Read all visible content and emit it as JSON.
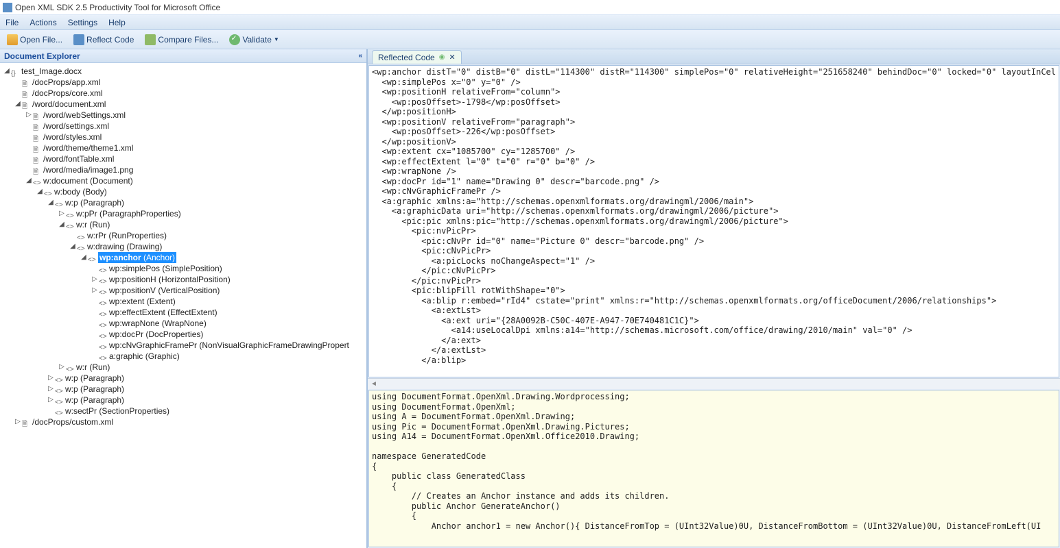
{
  "app": {
    "title": "Open XML SDK 2.5 Productivity Tool for Microsoft Office"
  },
  "menu": {
    "file": "File",
    "actions": "Actions",
    "settings": "Settings",
    "help": "Help"
  },
  "toolbar": {
    "open": "Open File...",
    "reflect": "Reflect Code",
    "compare": "Compare Files...",
    "validate": "Validate"
  },
  "explorer": {
    "title": "Document Explorer",
    "nodes": [
      {
        "d": 0,
        "t": "e",
        "i": "braces",
        "l": "test_Image.docx"
      },
      {
        "d": 1,
        "t": "l",
        "i": "doc",
        "l": "/docProps/app.xml"
      },
      {
        "d": 1,
        "t": "l",
        "i": "doc",
        "l": "/docProps/core.xml"
      },
      {
        "d": 1,
        "t": "e",
        "i": "doc",
        "l": "/word/document.xml"
      },
      {
        "d": 2,
        "t": "c",
        "i": "doc",
        "l": "/word/webSettings.xml"
      },
      {
        "d": 2,
        "t": "l",
        "i": "doc",
        "l": "/word/settings.xml"
      },
      {
        "d": 2,
        "t": "l",
        "i": "doc",
        "l": "/word/styles.xml"
      },
      {
        "d": 2,
        "t": "l",
        "i": "doc",
        "l": "/word/theme/theme1.xml"
      },
      {
        "d": 2,
        "t": "l",
        "i": "doc",
        "l": "/word/fontTable.xml"
      },
      {
        "d": 2,
        "t": "l",
        "i": "doc",
        "l": "/word/media/image1.png"
      },
      {
        "d": 2,
        "t": "e",
        "i": "tag",
        "l": "w:document (Document)"
      },
      {
        "d": 3,
        "t": "e",
        "i": "tag",
        "l": "w:body (Body)"
      },
      {
        "d": 4,
        "t": "e",
        "i": "tag",
        "l": "w:p (Paragraph)"
      },
      {
        "d": 5,
        "t": "c",
        "i": "tag",
        "l": "w:pPr (ParagraphProperties)"
      },
      {
        "d": 5,
        "t": "e",
        "i": "tag",
        "l": "w:r (Run)"
      },
      {
        "d": 6,
        "t": "l",
        "i": "tag",
        "l": "w:rPr (RunProperties)"
      },
      {
        "d": 6,
        "t": "e",
        "i": "tag",
        "l": "w:drawing (Drawing)"
      },
      {
        "d": 7,
        "t": "e",
        "i": "tag",
        "l": "wp:anchor (Anchor)",
        "sel": true,
        "bold": true
      },
      {
        "d": 8,
        "t": "l",
        "i": "tag",
        "l": "wp:simplePos (SimplePosition)"
      },
      {
        "d": 8,
        "t": "c",
        "i": "tag",
        "l": "wp:positionH (HorizontalPosition)"
      },
      {
        "d": 8,
        "t": "c",
        "i": "tag",
        "l": "wp:positionV (VerticalPosition)"
      },
      {
        "d": 8,
        "t": "l",
        "i": "tag",
        "l": "wp:extent (Extent)"
      },
      {
        "d": 8,
        "t": "l",
        "i": "tag",
        "l": "wp:effectExtent (EffectExtent)"
      },
      {
        "d": 8,
        "t": "l",
        "i": "tag",
        "l": "wp:wrapNone (WrapNone)"
      },
      {
        "d": 8,
        "t": "l",
        "i": "tag",
        "l": "wp:docPr (DocProperties)"
      },
      {
        "d": 8,
        "t": "l",
        "i": "tag",
        "l": "wp:cNvGraphicFramePr (NonVisualGraphicFrameDrawingPropert"
      },
      {
        "d": 8,
        "t": "l",
        "i": "tag",
        "l": "a:graphic (Graphic)"
      },
      {
        "d": 5,
        "t": "c",
        "i": "tag",
        "l": "w:r (Run)"
      },
      {
        "d": 4,
        "t": "c",
        "i": "tag",
        "l": "w:p (Paragraph)"
      },
      {
        "d": 4,
        "t": "c",
        "i": "tag",
        "l": "w:p (Paragraph)"
      },
      {
        "d": 4,
        "t": "c",
        "i": "tag",
        "l": "w:p (Paragraph)"
      },
      {
        "d": 4,
        "t": "l",
        "i": "tag",
        "l": "w:sectPr (SectionProperties)"
      },
      {
        "d": 1,
        "t": "c",
        "i": "doc",
        "l": "/docProps/custom.xml"
      }
    ]
  },
  "tab": {
    "label": "Reflected Code"
  },
  "xml_code": "<wp:anchor distT=\"0\" distB=\"0\" distL=\"114300\" distR=\"114300\" simplePos=\"0\" relativeHeight=\"251658240\" behindDoc=\"0\" locked=\"0\" layoutInCel\n  <wp:simplePos x=\"0\" y=\"0\" />\n  <wp:positionH relativeFrom=\"column\">\n    <wp:posOffset>-1798</wp:posOffset>\n  </wp:positionH>\n  <wp:positionV relativeFrom=\"paragraph\">\n    <wp:posOffset>-226</wp:posOffset>\n  </wp:positionV>\n  <wp:extent cx=\"1085700\" cy=\"1285700\" />\n  <wp:effectExtent l=\"0\" t=\"0\" r=\"0\" b=\"0\" />\n  <wp:wrapNone />\n  <wp:docPr id=\"1\" name=\"Drawing 0\" descr=\"barcode.png\" />\n  <wp:cNvGraphicFramePr />\n  <a:graphic xmlns:a=\"http://schemas.openxmlformats.org/drawingml/2006/main\">\n    <a:graphicData uri=\"http://schemas.openxmlformats.org/drawingml/2006/picture\">\n      <pic:pic xmlns:pic=\"http://schemas.openxmlformats.org/drawingml/2006/picture\">\n        <pic:nvPicPr>\n          <pic:cNvPr id=\"0\" name=\"Picture 0\" descr=\"barcode.png\" />\n          <pic:cNvPicPr>\n            <a:picLocks noChangeAspect=\"1\" />\n          </pic:cNvPicPr>\n        </pic:nvPicPr>\n        <pic:blipFill rotWithShape=\"0\">\n          <a:blip r:embed=\"rId4\" cstate=\"print\" xmlns:r=\"http://schemas.openxmlformats.org/officeDocument/2006/relationships\">\n            <a:extLst>\n              <a:ext uri=\"{28A0092B-C50C-407E-A947-70E740481C1C}\">\n                <a14:useLocalDpi xmlns:a14=\"http://schemas.microsoft.com/office/drawing/2010/main\" val=\"0\" />\n              </a:ext>\n            </a:extLst>\n          </a:blip>",
  "cs_code": "using DocumentFormat.OpenXml.Drawing.Wordprocessing;\nusing DocumentFormat.OpenXml;\nusing A = DocumentFormat.OpenXml.Drawing;\nusing Pic = DocumentFormat.OpenXml.Drawing.Pictures;\nusing A14 = DocumentFormat.OpenXml.Office2010.Drawing;\n\nnamespace GeneratedCode\n{\n    public class GeneratedClass\n    {\n        // Creates an Anchor instance and adds its children.\n        public Anchor GenerateAnchor()\n        {\n            Anchor anchor1 = new Anchor(){ DistanceFromTop = (UInt32Value)0U, DistanceFromBottom = (UInt32Value)0U, DistanceFromLeft(UI"
}
